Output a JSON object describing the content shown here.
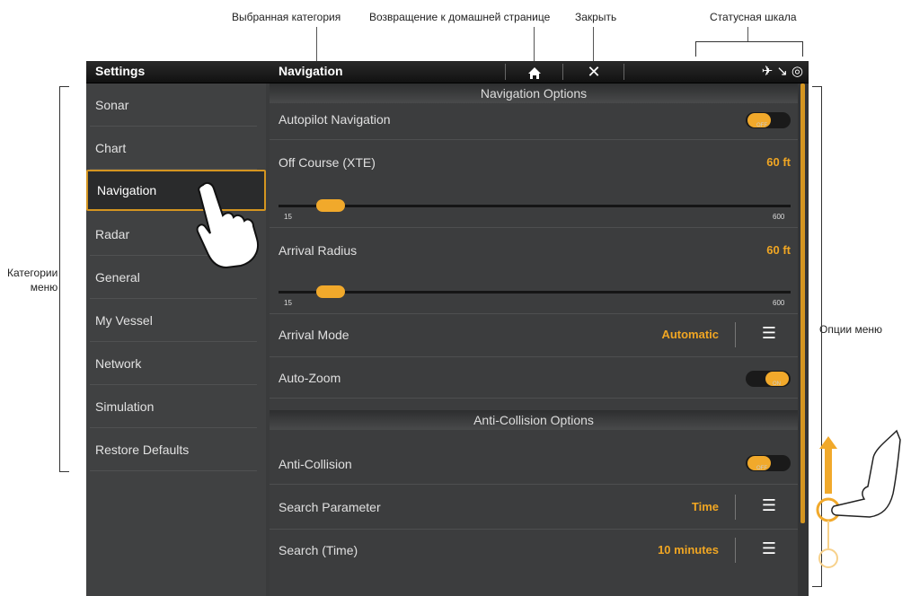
{
  "callouts": {
    "selected_category": "Выбранная категория",
    "home": "Возвращение к домашней странице",
    "close": "Закрыть",
    "status_bar": "Статусная шкала",
    "menu_categories": "Категории\nменю",
    "menu_options": "Опции меню"
  },
  "topbar": {
    "settings_title": "Settings",
    "section_title": "Navigation",
    "home_icon": "home-icon",
    "close_icon": "close-icon"
  },
  "sidebar": {
    "items": [
      {
        "label": "Sonar"
      },
      {
        "label": "Chart"
      },
      {
        "label": "Navigation",
        "selected": true
      },
      {
        "label": "Radar"
      },
      {
        "label": "General"
      },
      {
        "label": "My Vessel"
      },
      {
        "label": "Network"
      },
      {
        "label": "Simulation"
      },
      {
        "label": "Restore Defaults"
      }
    ]
  },
  "content": {
    "nav_options_header": "Navigation Options",
    "autopilot": {
      "label": "Autopilot Navigation",
      "state": "off"
    },
    "off_course": {
      "label": "Off Course (XTE)",
      "value": "60 ft",
      "min": "15",
      "max": "600"
    },
    "arrival_radius": {
      "label": "Arrival Radius",
      "value": "60 ft",
      "min": "15",
      "max": "600"
    },
    "arrival_mode": {
      "label": "Arrival Mode",
      "value": "Automatic"
    },
    "auto_zoom": {
      "label": "Auto-Zoom",
      "state": "on"
    },
    "anti_collision_header": "Anti-Collision Options",
    "anti_collision": {
      "label": "Anti-Collision",
      "state": "off"
    },
    "search_parameter": {
      "label": "Search Parameter",
      "value": "Time"
    },
    "search_time": {
      "label": "Search (Time)",
      "value": "10 minutes"
    }
  },
  "toggle_small": {
    "off": "OFF",
    "on": "ON"
  },
  "accent_color": "#f1a92b"
}
